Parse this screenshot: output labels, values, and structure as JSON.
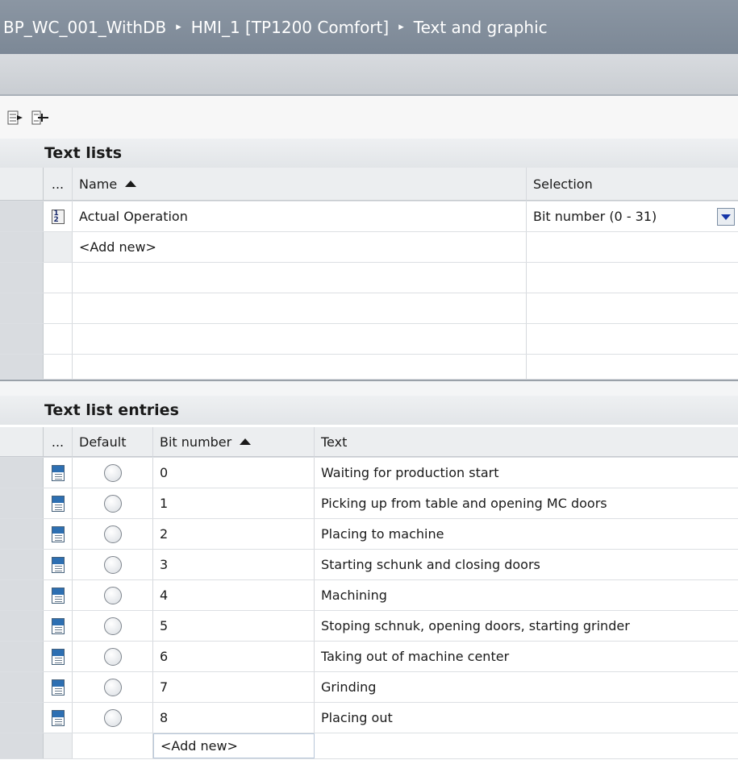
{
  "breadcrumb": [
    "BP_WC_001_WithDB",
    "HMI_1 [TP1200 Comfort]",
    "Text and graphic"
  ],
  "breadcrumb_separator": "▸",
  "toolbar": {
    "buttons": [
      {
        "name": "insert-row-icon"
      },
      {
        "name": "add-row-icon"
      }
    ]
  },
  "text_lists": {
    "title": "Text lists",
    "columns": {
      "more": "...",
      "name": "Name",
      "selection": "Selection"
    },
    "rows": [
      {
        "name": "Actual Operation",
        "selection": "Bit number (0 - 31)"
      }
    ],
    "add_new": "<Add new>"
  },
  "entries": {
    "title": "Text list entries",
    "columns": {
      "more": "...",
      "default": "Default",
      "bit_number": "Bit number",
      "text": "Text"
    },
    "rows": [
      {
        "bit": "0",
        "text": "Waiting for production start"
      },
      {
        "bit": "1",
        "text": "Picking up from table and opening MC doors"
      },
      {
        "bit": "2",
        "text": "Placing to machine"
      },
      {
        "bit": "3",
        "text": "Starting schunk and closing doors"
      },
      {
        "bit": "4",
        "text": "Machining"
      },
      {
        "bit": "5",
        "text": "Stoping schnuk, opening doors, starting grinder"
      },
      {
        "bit": "6",
        "text": "Taking out of machine center"
      },
      {
        "bit": "7",
        "text": "Grinding"
      },
      {
        "bit": "8",
        "text": "Placing out"
      }
    ],
    "add_new": "<Add new>"
  }
}
